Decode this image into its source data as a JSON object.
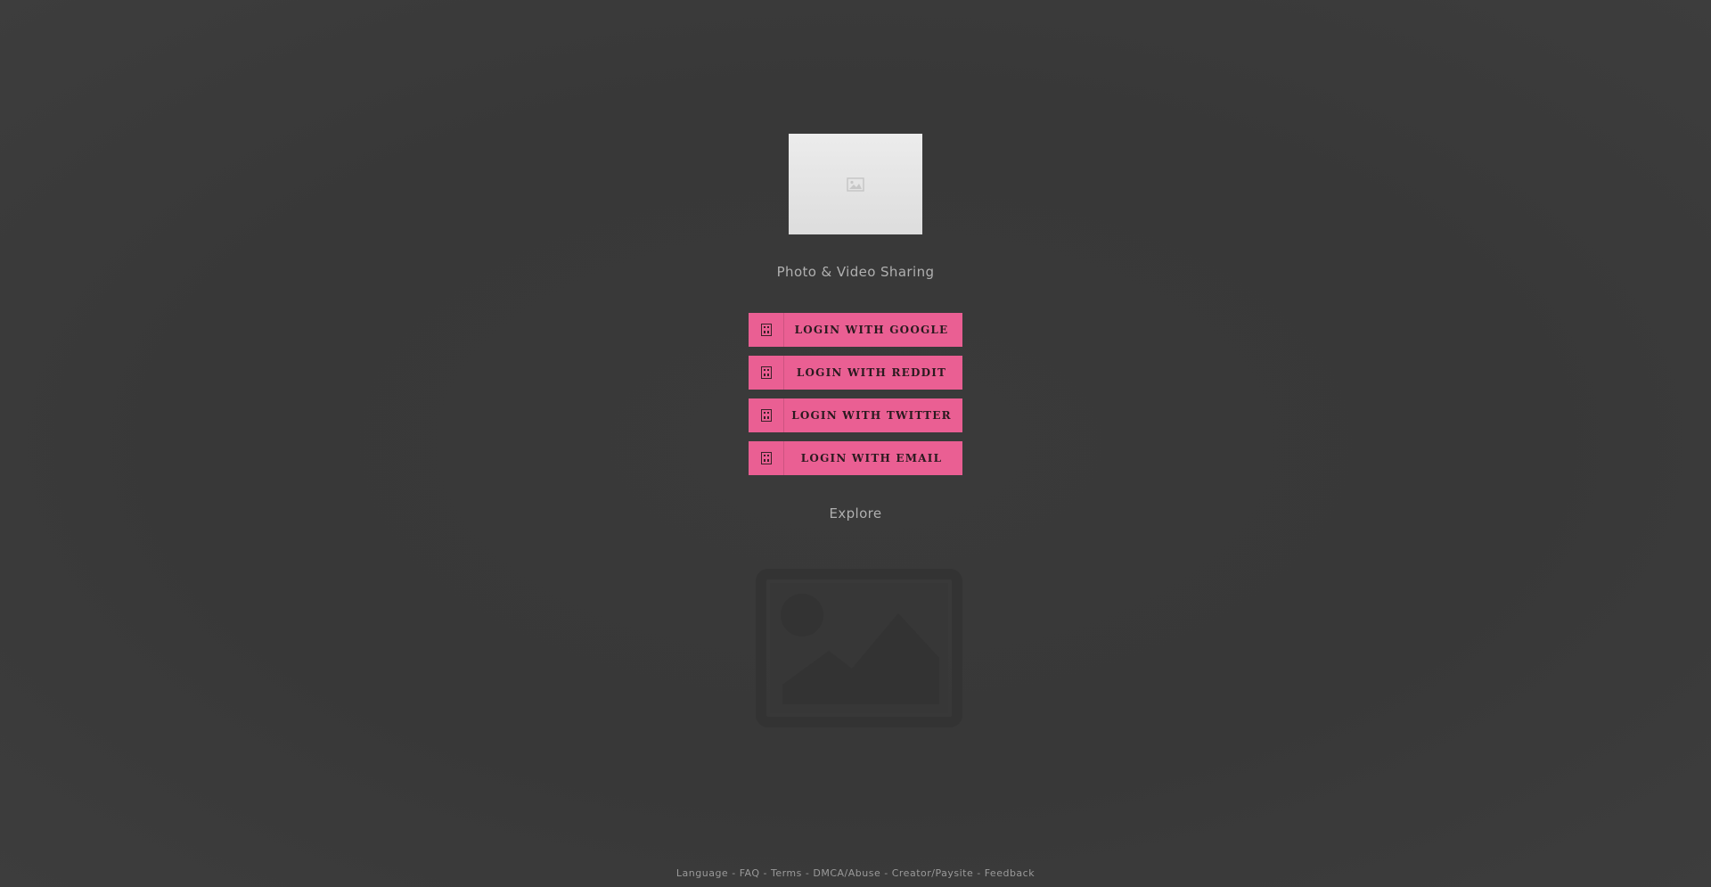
{
  "brand": {
    "logo_icon": "image-placeholder-icon",
    "tagline": "Photo & Video Sharing"
  },
  "login": {
    "buttons": [
      {
        "label": "LOGIN WITH GOOGLE",
        "icon": "google-icon"
      },
      {
        "label": "LOGIN WITH REDDIT",
        "icon": "reddit-icon"
      },
      {
        "label": "LOGIN WITH TWITTER",
        "icon": "twitter-icon"
      },
      {
        "label": "LOGIN WITH EMAIL",
        "icon": "email-icon"
      }
    ]
  },
  "explore": {
    "label": "Explore",
    "preview_icon": "image-placeholder-icon"
  },
  "footer": {
    "links": [
      "Language",
      "FAQ",
      "Terms",
      "DMCA/Abuse",
      "Creator/Paysite",
      "Feedback"
    ],
    "separator": "-"
  },
  "colors": {
    "background": "#3b3b3b",
    "accent": "#ea5f93",
    "text_muted": "#b0b0b0"
  }
}
